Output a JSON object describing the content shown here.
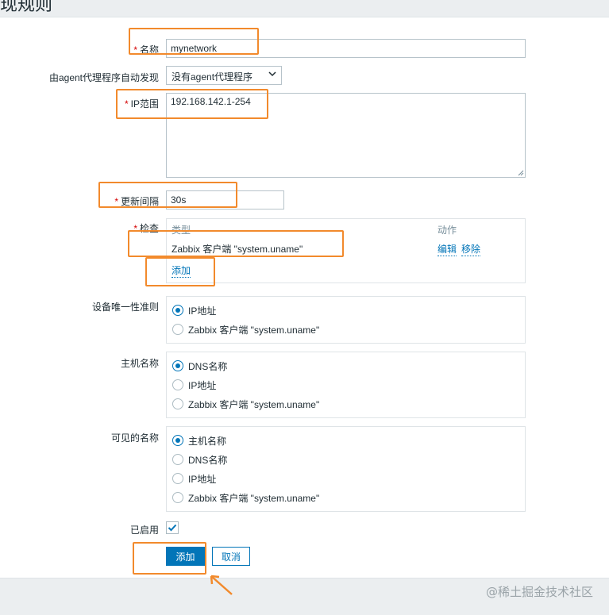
{
  "page": {
    "title": "现规则"
  },
  "form": {
    "name": {
      "label": "名称",
      "value": "mynetwork"
    },
    "proxy": {
      "label": "由agent代理程序自动发现",
      "value": "没有agent代理程序"
    },
    "ip_range": {
      "label": "IP范围",
      "value": "192.168.142.1-254"
    },
    "update_interval": {
      "label": "更新间隔",
      "value": "30s"
    },
    "checks": {
      "label": "检查",
      "col_type": "类型",
      "col_action": "动作",
      "rows": [
        {
          "type": "Zabbix 客户端 \"system.uname\"",
          "edit": "编辑",
          "remove": "移除"
        }
      ],
      "add": "添加"
    },
    "uniqueness": {
      "label": "设备唯一性准则",
      "options": [
        "IP地址",
        "Zabbix 客户端 \"system.uname\""
      ],
      "selected": 0
    },
    "host_name": {
      "label": "主机名称",
      "options": [
        "DNS名称",
        "IP地址",
        "Zabbix 客户端 \"system.uname\""
      ],
      "selected": 0
    },
    "visible_name": {
      "label": "可见的名称",
      "options": [
        "主机名称",
        "DNS名称",
        "IP地址",
        "Zabbix 客户端 \"system.uname\""
      ],
      "selected": 0
    },
    "enabled": {
      "label": "已启用",
      "checked": true
    },
    "buttons": {
      "add": "添加",
      "cancel": "取消"
    }
  },
  "watermark": "@稀土掘金技术社区",
  "colors": {
    "accent": "#0275b8",
    "highlight": "#f28a2c",
    "required": "#d40000"
  }
}
